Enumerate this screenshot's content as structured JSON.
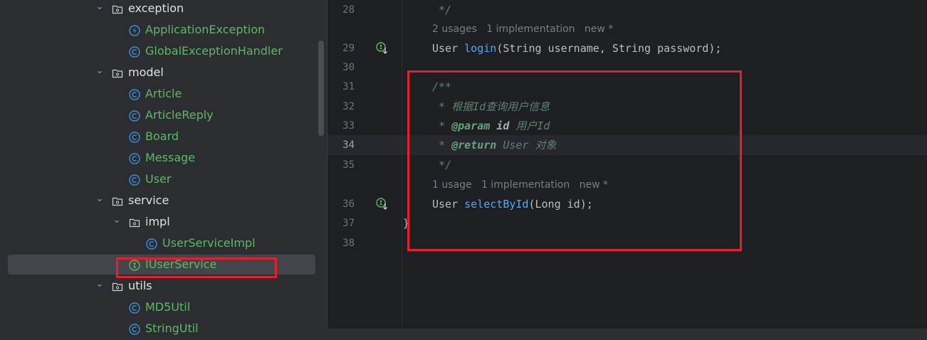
{
  "project_tree": {
    "items": [
      {
        "type": "folder",
        "label": "exception",
        "expanded": true,
        "depth": 0
      },
      {
        "type": "exception-class",
        "label": "ApplicationException",
        "depth": 1
      },
      {
        "type": "class",
        "label": "GlobalExceptionHandler",
        "depth": 1
      },
      {
        "type": "folder",
        "label": "model",
        "expanded": true,
        "depth": 0
      },
      {
        "type": "class",
        "label": "Article",
        "depth": 1
      },
      {
        "type": "class",
        "label": "ArticleReply",
        "depth": 1
      },
      {
        "type": "class",
        "label": "Board",
        "depth": 1
      },
      {
        "type": "class",
        "label": "Message",
        "depth": 1
      },
      {
        "type": "class",
        "label": "User",
        "depth": 1
      },
      {
        "type": "folder",
        "label": "service",
        "expanded": true,
        "depth": 0
      },
      {
        "type": "folder",
        "label": "impl",
        "expanded": true,
        "depth": 1
      },
      {
        "type": "class",
        "label": "UserServiceImpl",
        "depth": 2
      },
      {
        "type": "interface",
        "label": "IUserService",
        "depth": 1,
        "selected": true
      },
      {
        "type": "folder",
        "label": "utils",
        "expanded": true,
        "depth": 0
      },
      {
        "type": "class",
        "label": "MD5Util",
        "depth": 1
      },
      {
        "type": "class",
        "label": "StringUtil",
        "depth": 1
      }
    ]
  },
  "editor": {
    "current_line": "34",
    "lines": [
      {
        "n": "28",
        "kind": "doc",
        "text": " */"
      },
      {
        "kind": "hint",
        "text": "2 usages   1 implementation   new *"
      },
      {
        "n": "29",
        "kind": "method",
        "gutter_icon": "implemented-icon",
        "type": "User ",
        "name": "login",
        "params": "(String username, String password);"
      },
      {
        "n": "30",
        "kind": "blank"
      },
      {
        "n": "31",
        "kind": "doc",
        "text": "/**"
      },
      {
        "n": "32",
        "kind": "doc",
        "text": " * 根据Id查询用户信息"
      },
      {
        "n": "33",
        "kind": "param",
        "prefix": " * ",
        "tag": "@param",
        "pname": " id",
        "text": " 用户Id"
      },
      {
        "n": "34",
        "kind": "param",
        "prefix": " * ",
        "tag": "@return",
        "pname": "",
        "text": " User 对象"
      },
      {
        "n": "35",
        "kind": "doc",
        "text": " */"
      },
      {
        "kind": "hint",
        "text": "1 usage   1 implementation   new *"
      },
      {
        "n": "36",
        "kind": "method",
        "gutter_icon": "implemented-icon",
        "type": "User ",
        "name": "selectById",
        "params": "(Long id);"
      },
      {
        "n": "37",
        "kind": "brace",
        "text": "}"
      },
      {
        "n": "38",
        "kind": "blank"
      }
    ]
  },
  "colors": {
    "highlight_box": "#e3202b",
    "class_icon": "#3f8fd6",
    "interface_icon": "#5fb865",
    "label_green": "#5fb865"
  }
}
